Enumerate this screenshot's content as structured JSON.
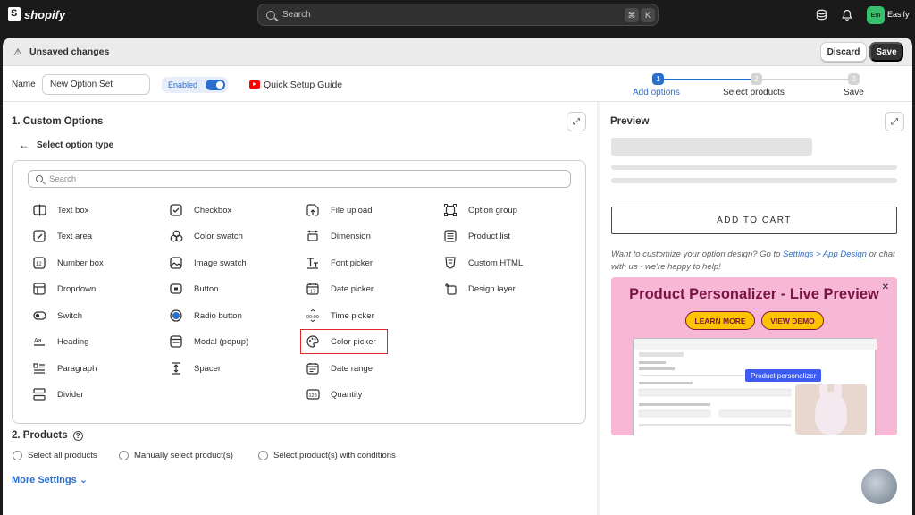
{
  "topbar": {
    "logo_text": "shopify",
    "search_placeholder": "Search",
    "shortcut_key1": "⌘",
    "shortcut_key2": "K",
    "avatar_initials": "Em",
    "store_name": "Easify"
  },
  "unsaved": {
    "message": "Unsaved changes",
    "discard_label": "Discard",
    "save_label": "Save"
  },
  "namebar": {
    "name_label": "Name",
    "name_value": "New Option Set",
    "enabled_label": "Enabled",
    "guide_label": "Quick Setup Guide",
    "steps": [
      {
        "num": "1",
        "label": "Add options",
        "active": true
      },
      {
        "num": "2",
        "label": "Select products",
        "active": false
      },
      {
        "num": "3",
        "label": "Save",
        "active": false
      }
    ]
  },
  "custom_options": {
    "title": "1. Custom Options",
    "back_label": "Select option type",
    "search_placeholder": "Search",
    "columns": [
      [
        {
          "label": "Text box",
          "icon": "text-box-icon"
        },
        {
          "label": "Text area",
          "icon": "text-area-icon"
        },
        {
          "label": "Number box",
          "icon": "number-box-icon"
        },
        {
          "label": "Dropdown",
          "icon": "dropdown-icon"
        },
        {
          "label": "Switch",
          "icon": "switch-icon"
        },
        {
          "label": "Heading",
          "icon": "heading-icon"
        },
        {
          "label": "Paragraph",
          "icon": "paragraph-icon"
        },
        {
          "label": "Divider",
          "icon": "divider-icon"
        }
      ],
      [
        {
          "label": "Checkbox",
          "icon": "checkbox-icon"
        },
        {
          "label": "Color swatch",
          "icon": "color-swatch-icon"
        },
        {
          "label": "Image swatch",
          "icon": "image-swatch-icon"
        },
        {
          "label": "Button",
          "icon": "button-icon"
        },
        {
          "label": "Radio button",
          "icon": "radio-button-icon"
        },
        {
          "label": "Modal (popup)",
          "icon": "modal-icon"
        },
        {
          "label": "Spacer",
          "icon": "spacer-icon"
        }
      ],
      [
        {
          "label": "File upload",
          "icon": "file-upload-icon"
        },
        {
          "label": "Dimension",
          "icon": "dimension-icon"
        },
        {
          "label": "Font picker",
          "icon": "font-picker-icon"
        },
        {
          "label": "Date picker",
          "icon": "date-picker-icon"
        },
        {
          "label": "Time picker",
          "icon": "time-picker-icon"
        },
        {
          "label": "Color picker",
          "icon": "color-picker-icon"
        },
        {
          "label": "Date range",
          "icon": "date-range-icon"
        },
        {
          "label": "Quantity",
          "icon": "quantity-icon"
        }
      ],
      [
        {
          "label": "Option group",
          "icon": "option-group-icon"
        },
        {
          "label": "Product list",
          "icon": "product-list-icon"
        },
        {
          "label": "Custom HTML",
          "icon": "custom-html-icon"
        },
        {
          "label": "Design layer",
          "icon": "design-layer-icon"
        }
      ]
    ]
  },
  "products": {
    "title": "2. Products",
    "options": [
      "Select all products",
      "Manually select product(s)",
      "Select product(s) with conditions"
    ]
  },
  "more_settings": "More Settings ⌄",
  "preview": {
    "title": "Preview",
    "add_to_cart": "ADD TO CART",
    "note_prefix": "Want to customize your option design? Go to ",
    "note_link1": "Settings > App Design",
    "note_mid": " or ",
    "note_link2": "chat with us",
    "note_suffix": " - we're happy to help!",
    "banner_title": "Product Personalizer - Live Preview",
    "learn_more": "LEARN MORE",
    "view_demo": "VIEW DEMO",
    "badge": "Product personalizer"
  },
  "colors": {
    "accent": "#2c6ecb",
    "highlight": "#e0262e",
    "banner_bg": "#f7b8d6"
  }
}
